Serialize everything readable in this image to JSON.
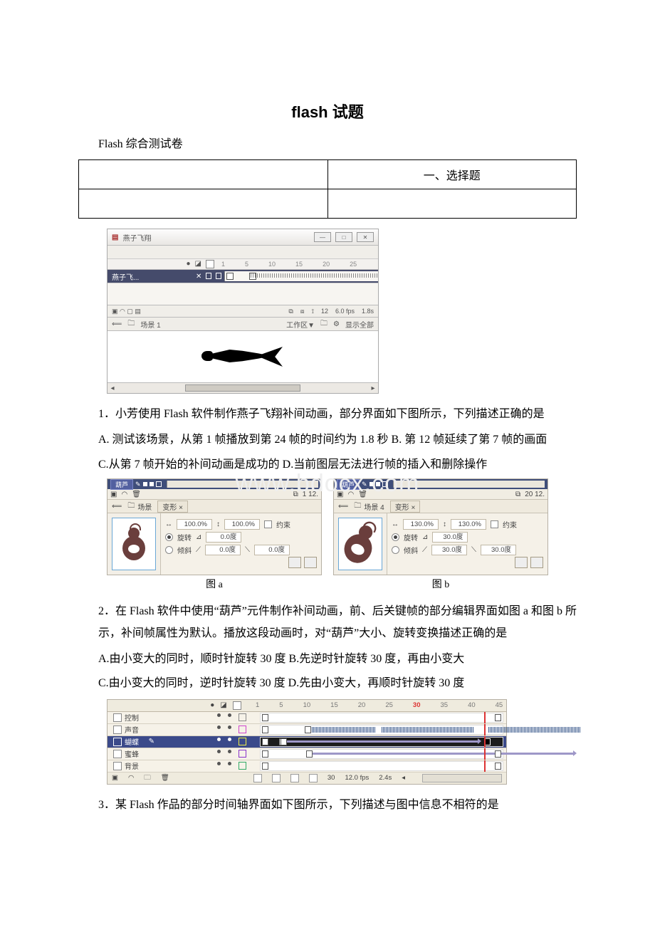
{
  "title": "flash 试题",
  "subtitle": "Flash 综合测试卷",
  "section_heading": "一、选择题",
  "watermark": "www.bdocx.com",
  "fig1": {
    "window_title": "燕子飞翔",
    "ruler_ticks": [
      "1",
      "5",
      "10",
      "15",
      "20",
      "25"
    ],
    "layer_name": "燕子飞...",
    "status": {
      "frame": "12",
      "fps": "6.0 fps",
      "sec": "1.8s"
    },
    "scene_name": "场景 1",
    "workspace_label": "工作区▼",
    "show_all": "显示全部"
  },
  "q1": {
    "stem": "1．小芳使用 Flash 软件制作燕子飞翔补间动画，部分界面如下图所示，下列描述正确的是",
    "optAB": "A. 测试该场景，从第 1 帧播放到第 24 帧的时间约为 1.8 秒 B. 第 12 帧延续了第 7 帧的画面",
    "optCD": "C.从第 7 帧开始的补间动画是成功的  D.当前图层无法进行帧的插入和删除操作"
  },
  "fig2": {
    "a": {
      "layer_tab": "葫芦",
      "scene_name": "场景",
      "panel_tab": "变形 ×",
      "scaleW": "100.0%",
      "scaleH": "100.0%",
      "lock": "约束",
      "mode_rotate": "旋转",
      "rotate_v": "0.0度",
      "mode_skew": "倾斜",
      "skew1": "0.0度",
      "skew2": "0.0度",
      "ruler": "1      12.",
      "caption": "图 a"
    },
    "b": {
      "layer_tab": "葫芦",
      "scene_name": "场景 4",
      "panel_tab": "变形 ×",
      "scaleW": "130.0%",
      "scaleH": "130.0%",
      "lock": "约束",
      "mode_rotate": "旋转",
      "rotate_v": "30.0度",
      "mode_skew": "倾斜",
      "skew1": "30.0度",
      "skew2": "30.0度",
      "ruler": "20     12.",
      "caption": "图 b"
    }
  },
  "q2": {
    "stem": "2．在 Flash 软件中使用“葫芦”元件制作补间动画，前、后关键帧的部分编辑界面如图 a 和图 b 所示，补间帧属性为默认。播放这段动画时，对“葫芦”大小、旋转变换描述正确的是",
    "optAB": "A.由小变大的同时，顺时针旋转 30 度  B.先逆时针旋转 30 度，再由小变大",
    "optCD": "C.由小变大的同时，逆时针旋转 30 度  D.先由小变大，再顺时针旋转 30 度"
  },
  "fig3": {
    "ruler_ticks": [
      "1",
      "5",
      "10",
      "15",
      "20",
      "25",
      "30",
      "35",
      "40",
      "45"
    ],
    "layers": [
      "控制",
      "声音",
      "蝴蝶",
      "蜜蜂",
      "背景"
    ],
    "status": {
      "frame": "30",
      "fps": "12.0 fps",
      "sec": "2.4s"
    }
  },
  "q3": {
    "stem": "3．某 Flash 作品的部分时间轴界面如下图所示，下列描述与图中信息不相符的是"
  }
}
